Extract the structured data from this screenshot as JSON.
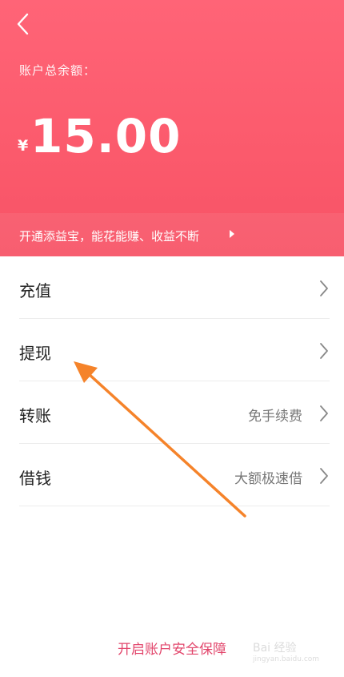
{
  "header": {
    "balance_label": "账户总余额：",
    "currency": "¥",
    "amount": "15.00",
    "promo_text": "开通添益宝，能花能赚、收益不断"
  },
  "menu": {
    "items": [
      {
        "label": "充值",
        "note": ""
      },
      {
        "label": "提现",
        "note": ""
      },
      {
        "label": "转账",
        "note": "免手续费"
      },
      {
        "label": "借钱",
        "note": "大额极速借"
      }
    ]
  },
  "footer": {
    "security_link": "开启账户安全保障"
  },
  "watermark": {
    "text": "Bai 经验",
    "sub": "jingyan.baidu.com"
  },
  "colors": {
    "header_top": "#ff6477",
    "header_bottom": "#f75266",
    "footer_link": "#e2456b",
    "annotation_arrow": "#f5832a"
  },
  "icons": {
    "back": "chevron-left-icon",
    "promo": "triangle-right-icon",
    "row": "chevron-right-icon"
  }
}
